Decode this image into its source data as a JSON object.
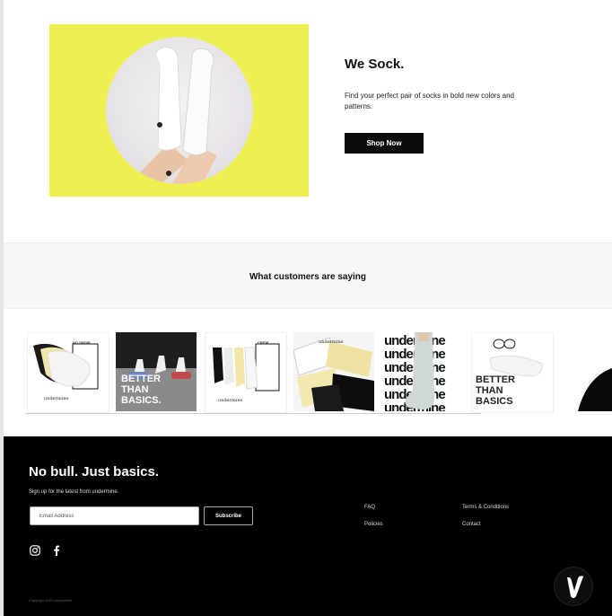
{
  "hero": {
    "title": "We Sock.",
    "subtitle": "Find your perfect pair of socks in bold new colors and patterns.",
    "cta_label": "Shop Now",
    "background_color": "#eef051"
  },
  "reviews": {
    "title": "What customers are saying"
  },
  "gallery": {
    "tiles": [
      {
        "small_label": "NO SHOW",
        "brand": "undermine"
      },
      {
        "caption_lines": [
          "BETTER",
          "THAN",
          "BASICS."
        ]
      },
      {
        "small_label": "CREW",
        "brand": "undermine"
      },
      {
        "brand": "undermine"
      },
      {
        "wordmark_rows": [
          "undermine",
          "undermine",
          "undermine",
          "undermine",
          "undermine",
          "undermine"
        ]
      },
      {
        "caption_lines": [
          "BETTER",
          "THAN",
          "BASICS"
        ]
      }
    ]
  },
  "footer": {
    "heading": "No bull. Just basics.",
    "subheading": "Sign up for the latest from undermine.",
    "email_placeholder": "Email Address",
    "subscribe_label": "Subscribe",
    "links_col1": [
      "FAQ",
      "Policies"
    ],
    "links_col2": [
      "Terms & Conditions",
      "Contact"
    ],
    "copyright": "Copyright 2021 Undermine",
    "social_icons": [
      "instagram-icon",
      "facebook-icon"
    ]
  }
}
